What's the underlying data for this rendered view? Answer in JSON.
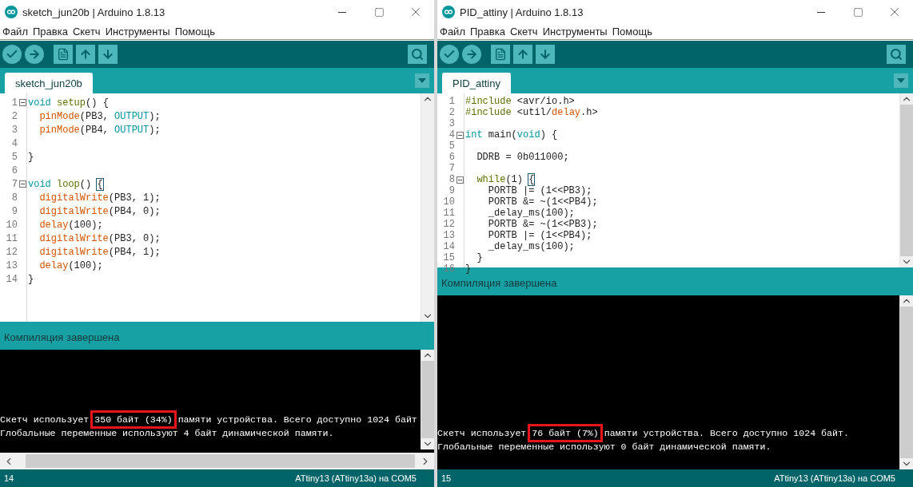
{
  "windows": [
    {
      "title": "sketch_jun20b | Arduino 1.8.13",
      "menu": [
        "Файл",
        "Правка",
        "Скетч",
        "Инструменты",
        "Помощь"
      ],
      "tabs": [
        {
          "label": "sketch_jun20b",
          "selected": true
        }
      ],
      "code": [
        {
          "number": "1",
          "fold": true,
          "tokens": [
            {
              "text": "void ",
              "kind": "keyword"
            },
            {
              "text": "setup",
              "kind": "structure"
            },
            {
              "text": "() {",
              "kind": "plain"
            }
          ]
        },
        {
          "number": "2",
          "fold": false,
          "tokens": [
            {
              "text": "  pinMode",
              "kind": "function"
            },
            {
              "text": "(PB3, ",
              "kind": "plain"
            },
            {
              "text": "OUTPUT",
              "kind": "keyword"
            },
            {
              "text": ");",
              "kind": "plain"
            }
          ]
        },
        {
          "number": "3",
          "fold": false,
          "tokens": [
            {
              "text": "  pinMode",
              "kind": "function"
            },
            {
              "text": "(PB4, ",
              "kind": "plain"
            },
            {
              "text": "OUTPUT",
              "kind": "keyword"
            },
            {
              "text": ");",
              "kind": "plain"
            }
          ]
        },
        {
          "number": "4",
          "fold": false
        },
        {
          "number": "5",
          "fold": false,
          "tokens": [
            {
              "text": "}",
              "kind": "plain"
            }
          ]
        },
        {
          "number": "6",
          "fold": false
        },
        {
          "number": "7",
          "fold": true,
          "tokens": [
            {
              "text": "void ",
              "kind": "keyword"
            },
            {
              "text": "loop",
              "kind": "structure"
            },
            {
              "text": "() ",
              "kind": "plain"
            },
            {
              "text": "{",
              "kind": "matched-brace"
            }
          ]
        },
        {
          "number": "8",
          "fold": false,
          "tokens": [
            {
              "text": "  digitalWrite",
              "kind": "function"
            },
            {
              "text": "(PB3, 1);",
              "kind": "plain"
            }
          ]
        },
        {
          "number": "9",
          "fold": false,
          "tokens": [
            {
              "text": "  digitalWrite",
              "kind": "function"
            },
            {
              "text": "(PB4, 0);",
              "kind": "plain"
            }
          ]
        },
        {
          "number": "10",
          "fold": false,
          "tokens": [
            {
              "text": "  delay",
              "kind": "function"
            },
            {
              "text": "(100);",
              "kind": "plain"
            }
          ]
        },
        {
          "number": "11",
          "fold": false,
          "tokens": [
            {
              "text": "  digitalWrite",
              "kind": "function"
            },
            {
              "text": "(PB3, 0);",
              "kind": "plain"
            }
          ]
        },
        {
          "number": "12",
          "fold": false,
          "tokens": [
            {
              "text": "  digitalWrite",
              "kind": "function"
            },
            {
              "text": "(PB4, 1);",
              "kind": "plain"
            }
          ]
        },
        {
          "number": "13",
          "fold": false,
          "tokens": [
            {
              "text": "  delay",
              "kind": "function"
            },
            {
              "text": "(100);",
              "kind": "plain"
            }
          ]
        },
        {
          "number": "14",
          "fold": false,
          "tokens": [
            {
              "text": "}",
              "kind": "plain"
            }
          ]
        }
      ],
      "status_message": "Компиляция завершена",
      "console": [
        [
          {
            "text": "Скетч использует ",
            "boxed": false
          },
          {
            "text": "350 байт (34%)",
            "boxed": true
          },
          {
            "text": " памяти устройства. Всего доступно 1024 байт",
            "boxed": false
          }
        ],
        [
          {
            "text": "Глобальные переменные используют 4 байт динамической памяти.",
            "boxed": false
          }
        ]
      ],
      "horizontal_scrollbar": true,
      "line_number": "14",
      "board": "ATtiny13 (ATtiny13a) на COM5"
    },
    {
      "title": "PID_attiny | Arduino 1.8.13",
      "menu": [
        "Файл",
        "Правка",
        "Скетч",
        "Инструменты",
        "Помощь"
      ],
      "tabs": [
        {
          "label": "PID_attiny",
          "selected": true
        }
      ],
      "code": [
        {
          "number": "1",
          "fold": false,
          "tokens": [
            {
              "text": "#include",
              "kind": "structure"
            },
            {
              "text": " <avr/io.h>",
              "kind": "plain"
            }
          ]
        },
        {
          "number": "2",
          "fold": false,
          "tokens": [
            {
              "text": "#include",
              "kind": "structure"
            },
            {
              "text": " <util/",
              "kind": "plain"
            },
            {
              "text": "delay",
              "kind": "function"
            },
            {
              "text": ".h>",
              "kind": "plain"
            }
          ]
        },
        {
          "number": "3",
          "fold": false
        },
        {
          "number": "4",
          "fold": true,
          "tokens": [
            {
              "text": "int",
              "kind": "keyword"
            },
            {
              "text": " main(",
              "kind": "plain"
            },
            {
              "text": "void",
              "kind": "keyword"
            },
            {
              "text": ") {",
              "kind": "plain"
            }
          ]
        },
        {
          "number": "5",
          "fold": false
        },
        {
          "number": "6",
          "fold": false,
          "tokens": [
            {
              "text": "  DDRB = 0b011000;",
              "kind": "plain"
            }
          ]
        },
        {
          "number": "7",
          "fold": false
        },
        {
          "number": "8",
          "fold": true,
          "tokens": [
            {
              "text": "  while",
              "kind": "structure"
            },
            {
              "text": "(1) ",
              "kind": "plain"
            },
            {
              "text": "{",
              "kind": "matched-brace"
            }
          ]
        },
        {
          "number": "9",
          "fold": false,
          "tokens": [
            {
              "text": "    PORTB |= (1<<PB3);",
              "kind": "plain"
            }
          ]
        },
        {
          "number": "10",
          "fold": false,
          "tokens": [
            {
              "text": "    PORTB &= ~(1<<PB4);",
              "kind": "plain"
            }
          ]
        },
        {
          "number": "11",
          "fold": false,
          "tokens": [
            {
              "text": "    _delay_ms(100);",
              "kind": "plain"
            }
          ]
        },
        {
          "number": "12",
          "fold": false,
          "tokens": [
            {
              "text": "    PORTB &= ~(1<<PB3);",
              "kind": "plain"
            }
          ]
        },
        {
          "number": "13",
          "fold": false,
          "tokens": [
            {
              "text": "    PORTB |= (1<<PB4);",
              "kind": "plain"
            }
          ]
        },
        {
          "number": "14",
          "fold": false,
          "tokens": [
            {
              "text": "    _delay_ms(100);",
              "kind": "plain"
            }
          ]
        },
        {
          "number": "15",
          "fold": false,
          "tokens": [
            {
              "text": "  }",
              "kind": "plain"
            }
          ]
        },
        {
          "number": "16",
          "fold": false,
          "tokens": [
            {
              "text": "}",
              "kind": "plain"
            }
          ]
        }
      ],
      "status_message": "Компиляция завершена",
      "console": [
        [
          {
            "text": "Скетч использует ",
            "boxed": false
          },
          {
            "text": "76 байт (7%)",
            "boxed": true
          },
          {
            "text": " памяти устройства. Всего доступно 1024 байт.",
            "boxed": false
          }
        ],
        [
          {
            "text": "Глобальные переменные используют 0 байт динамической памяти.",
            "boxed": false
          }
        ]
      ],
      "horizontal_scrollbar": false,
      "line_number": "15",
      "board": "ATtiny13 (ATtiny13a) на COM5"
    }
  ]
}
